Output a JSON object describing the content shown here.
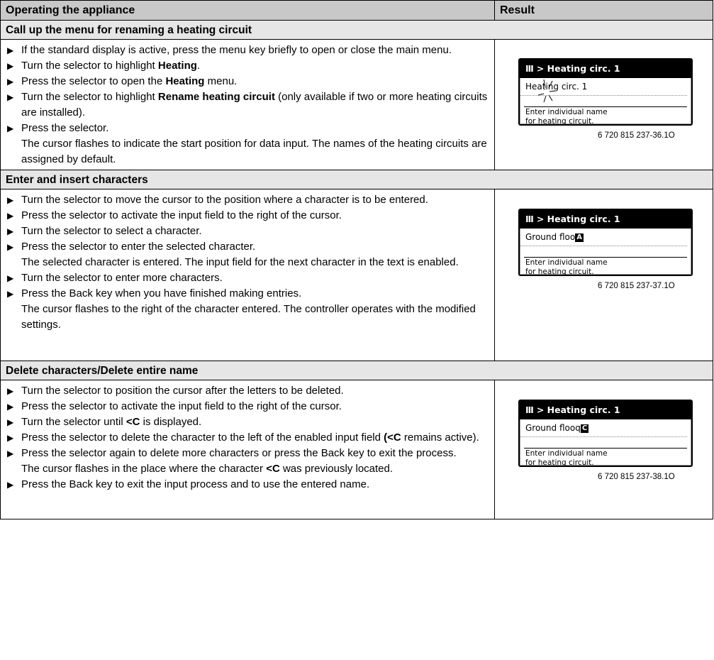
{
  "header": {
    "col1": "Operating the appliance",
    "col2": "Result"
  },
  "sections": [
    {
      "title": "Call up the menu for renaming a heating circuit",
      "steps": [
        "If the standard display is active, press the menu key briefly to open or close the main menu.",
        "Turn the selector to highlight Heating.",
        "Press the selector to open the Heating menu.",
        "Turn the selector to highlight Rename heating circuit (only available if two or more heating circuits are installed).",
        "Press the selector."
      ],
      "result_text": "The cursor flashes to indicate the start position for data input. The names of the heating circuits are assigned by default.",
      "screen": {
        "title": "Heating circ. 1",
        "field": "Heating circ. 1",
        "hint_line1": "Enter individual name",
        "hint_line2": "for heating circuit."
      },
      "figure_code": "6 720 815 237-36.1O"
    },
    {
      "title": "Enter and insert characters",
      "steps": [
        "Turn the selector to move the cursor to the position where a character is to be entered.",
        "Press the selector to activate the input field to the right of the cursor.",
        "Turn the selector to select a character.",
        "Press the selector to enter the selected character.",
        "Turn the selector to enter more characters.",
        "Press the Back key when you have finished making entries."
      ],
      "result_text_a": "The selected character is entered. The input field for the next character in the text is enabled.",
      "result_text_b": "The cursor flashes to the right of the character entered. The controller operates with the modified settings.",
      "screen": {
        "title": "Heating circ. 1",
        "field": "Ground floo",
        "cursor_char": "A",
        "hint_line1": "Enter individual name",
        "hint_line2": "for heating circuit."
      },
      "figure_code": "6 720 815 237-37.1O"
    },
    {
      "title": "Delete characters/Delete entire name",
      "steps": [
        "Turn the selector to position the cursor after the letters to be deleted.",
        "Press the selector to activate the input field to the right of the cursor.",
        "Turn the selector until <C is displayed.",
        "Press the selector to delete the character to the left of the enabled input field (<C remains active).",
        "Press the selector again to delete more characters or press the Back key to exit the process.",
        "Press the Back key to exit the input process and to use the entered name."
      ],
      "result_text": "The cursor flashes in the place where the character <C was previously located.",
      "screen": {
        "title": "Heating circ. 1",
        "field": "Ground flooq",
        "cursor_char": "C",
        "hint_line1": "Enter individual name",
        "hint_line2": "for heating circuit."
      },
      "figure_code": "6 720 815 237-38.1O"
    }
  ],
  "icons": {
    "bullet": "triangle-right-icon",
    "menu_symbol": "heating-icon"
  }
}
